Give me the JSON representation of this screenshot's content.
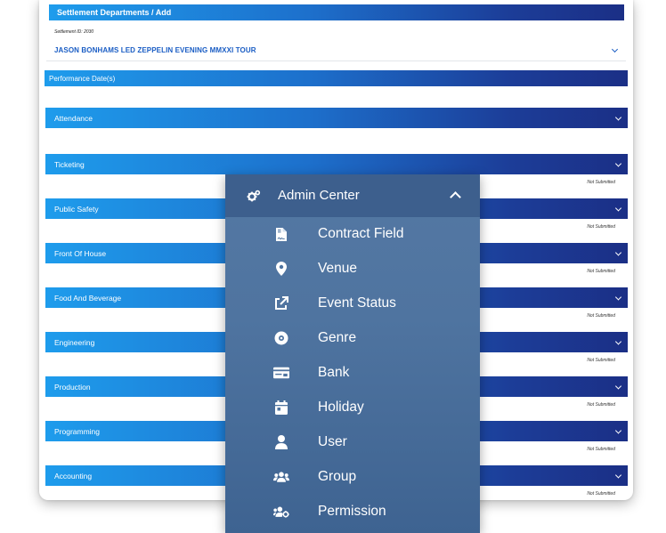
{
  "header": {
    "title": "Settlement Departments / Add"
  },
  "settlement": {
    "id_label": "Settlement ID: 2030",
    "event": "JASON BONHAMS LED ZEPPELIN EVENING MMXXI TOUR"
  },
  "performance": {
    "label": "Performance Date(s)"
  },
  "sections": [
    {
      "label": "Attendance",
      "status": ""
    },
    {
      "label": "Ticketing",
      "status": "Not Submitted"
    },
    {
      "label": "Public Safety",
      "status": "Not Submitted"
    },
    {
      "label": "Front Of House",
      "status": "Not Submitted"
    },
    {
      "label": "Food And Beverage",
      "status": "Not Submitted"
    },
    {
      "label": "Engineering",
      "status": "Not Submitted"
    },
    {
      "label": "Production",
      "status": "Not Submitted"
    },
    {
      "label": "Programming",
      "status": "Not Submitted"
    },
    {
      "label": "Accounting",
      "status": "Not Submitted"
    }
  ],
  "menu": {
    "title": "Admin Center",
    "title_icon": "cogs-icon",
    "items": [
      {
        "label": "Contract Field",
        "icon": "file-contract-icon"
      },
      {
        "label": "Venue",
        "icon": "map-marker-icon"
      },
      {
        "label": "Event Status",
        "icon": "external-link-icon"
      },
      {
        "label": "Genre",
        "icon": "compact-disc-icon"
      },
      {
        "label": "Bank",
        "icon": "money-check-icon"
      },
      {
        "label": "Holiday",
        "icon": "calendar-day-icon"
      },
      {
        "label": "User",
        "icon": "user-icon"
      },
      {
        "label": "Group",
        "icon": "users-icon"
      },
      {
        "label": "Permission",
        "icon": "users-cog-icon"
      }
    ]
  }
}
